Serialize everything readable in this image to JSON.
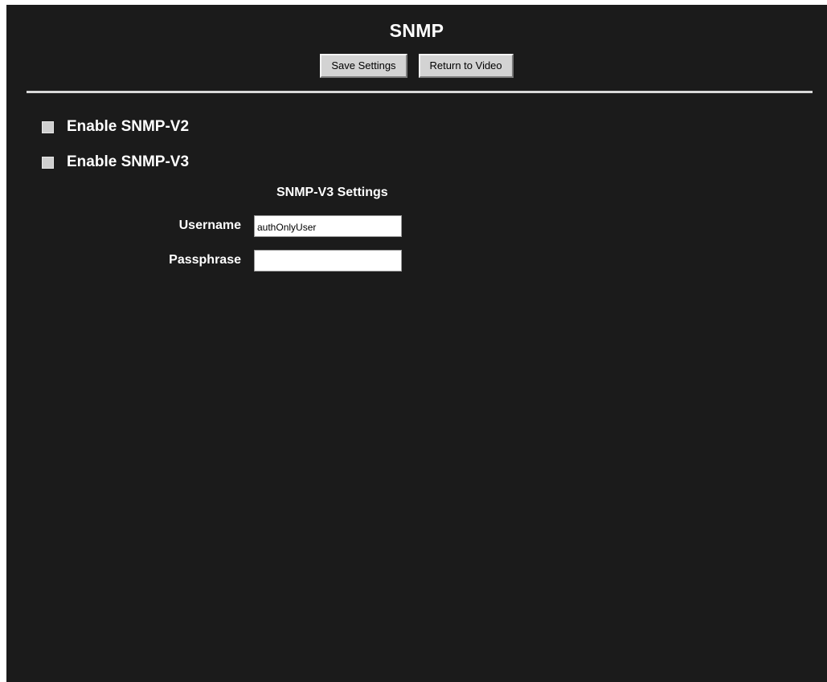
{
  "page": {
    "title": "SNMP"
  },
  "toolbar": {
    "save_label": "Save Settings",
    "return_label": "Return to Video"
  },
  "options": {
    "snmp_v2": {
      "label": "Enable SNMP-V2",
      "checked": false
    },
    "snmp_v3": {
      "label": "Enable SNMP-V3",
      "checked": false
    }
  },
  "v3_settings": {
    "title": "SNMP-V3 Settings",
    "username": {
      "label": "Username",
      "value": "authOnlyUser"
    },
    "passphrase": {
      "label": "Passphrase",
      "value": ""
    }
  },
  "colors": {
    "background": "#1b1b1b",
    "text": "#ffffff",
    "button": "#d3d3d3"
  }
}
